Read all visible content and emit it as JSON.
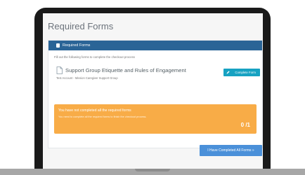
{
  "page": {
    "title": "Required Forms"
  },
  "panel": {
    "header_label": "Required Forms",
    "instructions": "Fill out the following forms to complete the checkout process"
  },
  "form": {
    "title": "Support Group Etiquette and Rules of Engagement",
    "subtitle": "Test Account - Mission Caregiver Support Group",
    "button_label": "Complete Form"
  },
  "alert": {
    "title": "You have not completed all the required forms",
    "text": "You need to complete all the required forms to finish the checkout process.",
    "count": "0 /1"
  },
  "footer": {
    "submit_label": "I Have Completed All Forms »"
  },
  "colors": {
    "panel_header": "#2a6496",
    "complete_button": "#17a2c2",
    "alert": "#f8ac47",
    "submit_button": "#4a90d9"
  },
  "icons": {
    "header": "document-icon",
    "form": "document-outline-icon",
    "button": "pencil-icon"
  }
}
